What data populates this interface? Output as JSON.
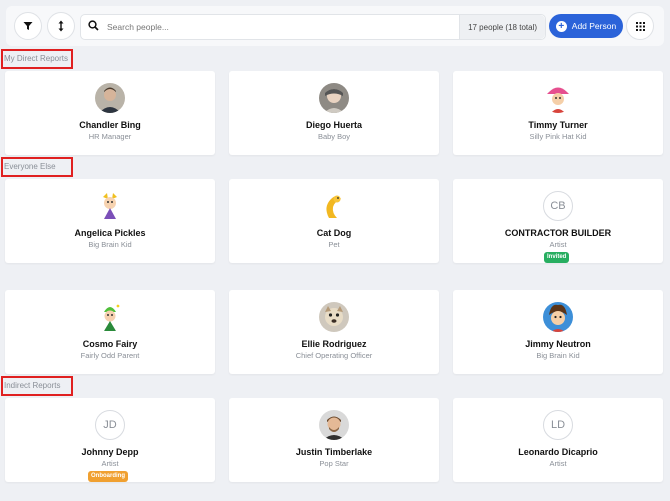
{
  "toolbar": {
    "search_placeholder": "Search people...",
    "count_text": "17 people (18 total)",
    "add_label": "Add Person"
  },
  "sections": [
    {
      "label": "My Direct Reports"
    },
    {
      "label": "Everyone Else"
    },
    {
      "label": "Indirect Reports"
    }
  ],
  "people": [
    {
      "name": "Chandler Bing",
      "role": "HR Manager",
      "avatar": "photo-chandler"
    },
    {
      "name": "Diego Huerta",
      "role": "Baby Boy",
      "avatar": "photo-diego"
    },
    {
      "name": "Timmy Turner",
      "role": "Silly Pink Hat Kid",
      "avatar": "cartoon-timmy"
    },
    {
      "name": "Angelica Pickles",
      "role": "Big Brain Kid",
      "avatar": "cartoon-angelica"
    },
    {
      "name": "Cat Dog",
      "role": "Pet",
      "avatar": "cartoon-catdog"
    },
    {
      "name": "CONTRACTOR BUILDER",
      "role": "Artist",
      "initials": "CB",
      "badge": "Invited",
      "badge_color": "#27ae60"
    },
    {
      "name": "Cosmo Fairy",
      "role": "Fairly Odd Parent",
      "avatar": "cartoon-cosmo"
    },
    {
      "name": "Ellie Rodriguez",
      "role": "Chief Operating Officer",
      "avatar": "photo-ellie"
    },
    {
      "name": "Jimmy Neutron",
      "role": "Big Brain Kid",
      "avatar": "cartoon-jimmy"
    },
    {
      "name": "Johnny Depp",
      "role": "Artist",
      "initials": "JD",
      "badge": "Onboarding",
      "badge_color": "#f0a030"
    },
    {
      "name": "Justin Timberlake",
      "role": "Pop Star",
      "avatar": "photo-justin"
    },
    {
      "name": "Leonardo Dicaprio",
      "role": "Artist",
      "initials": "LD"
    }
  ],
  "colors": {
    "accent": "#2b63d9",
    "highlight_box": "#e02020"
  }
}
